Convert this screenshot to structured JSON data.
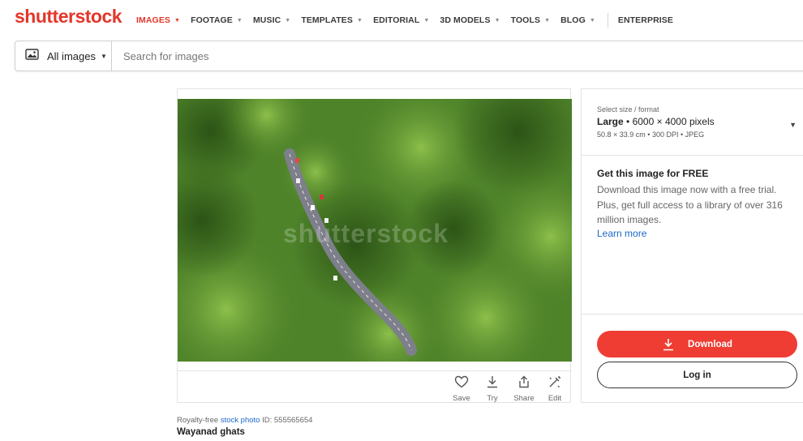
{
  "brand": {
    "logo_text": "shutterstock",
    "accent": "#e2372a"
  },
  "nav": {
    "items": [
      {
        "label": "IMAGES",
        "active": true,
        "has_dropdown": true
      },
      {
        "label": "FOOTAGE",
        "has_dropdown": true
      },
      {
        "label": "MUSIC",
        "has_dropdown": true
      },
      {
        "label": "TEMPLATES",
        "has_dropdown": true
      },
      {
        "label": "EDITORIAL",
        "has_dropdown": true
      },
      {
        "label": "3D MODELS",
        "has_dropdown": true
      },
      {
        "label": "TOOLS",
        "has_dropdown": true
      },
      {
        "label": "BLOG",
        "has_dropdown": true
      }
    ],
    "enterprise_label": "ENTERPRISE"
  },
  "search": {
    "type_label": "All images",
    "placeholder": "Search for images",
    "value": ""
  },
  "image": {
    "watermark": "shutterstock",
    "actions": [
      {
        "label": "Save",
        "icon": "heart-icon"
      },
      {
        "label": "Try",
        "icon": "download-arrow-icon"
      },
      {
        "label": "Share",
        "icon": "share-icon"
      },
      {
        "label": "Edit",
        "icon": "edit-wand-icon"
      }
    ]
  },
  "caption": {
    "prefix": "Royalty-free",
    "link": "stock photo",
    "id_text": "ID: 555565654",
    "title": "Wayanad ghats"
  },
  "purchase": {
    "size_label": "Select size / format",
    "size_name": "Large",
    "size_pixels": "• 6000 × 4000 pixels",
    "size_details": "50.8 × 33.9 cm • 300 DPI • JPEG",
    "promo_title": "Get this image for FREE",
    "promo_body": "Download this image now with a free trial. Plus, get full access to a library of over 316 million images.",
    "promo_link": "Learn more",
    "download_label": "Download",
    "login_label": "Log in",
    "download_color": "#ef3d33",
    "link_color": "#1c68c9"
  }
}
